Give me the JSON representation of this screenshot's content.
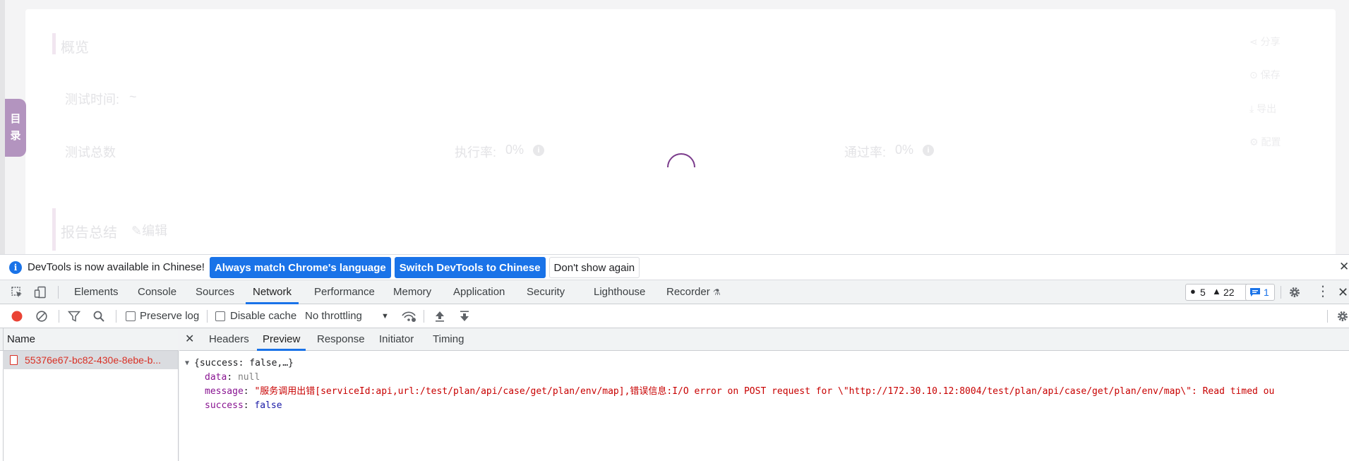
{
  "page": {
    "toc_tab": [
      "目",
      "录"
    ],
    "overview_title": "概览",
    "test_time_label": "测试时间:",
    "test_time_value": "~",
    "test_total_label": "测试总数",
    "exec_rate_label": "执行率:",
    "exec_rate_value": "0%",
    "pass_rate_label": "通过率:",
    "pass_rate_value": "0%",
    "report_summary_title": "报告总结",
    "edit_label": "编辑",
    "side_actions": [
      "分享",
      "保存",
      "导出",
      "配置"
    ]
  },
  "infobar": {
    "message": "DevTools is now available in Chinese!",
    "btn_match": "Always match Chrome's language",
    "btn_switch": "Switch DevTools to Chinese",
    "btn_dismiss": "Don't show again"
  },
  "main_tabs": [
    "Elements",
    "Console",
    "Sources",
    "Network",
    "Performance",
    "Memory",
    "Application",
    "Security",
    "Lighthouse",
    "Recorder"
  ],
  "active_main_tab": "Network",
  "badges": {
    "errors": "5",
    "warnings": "22",
    "messages": "1"
  },
  "network_toolbar": {
    "preserve_log": "Preserve log",
    "disable_cache": "Disable cache",
    "throttling": "No throttling"
  },
  "request_list": {
    "header": "Name",
    "rows": [
      {
        "name": "55376e67-bc82-430e-8ebe-b..."
      }
    ]
  },
  "detail_tabs": [
    "Headers",
    "Preview",
    "Response",
    "Initiator",
    "Timing"
  ],
  "active_detail_tab": "Preview",
  "preview": {
    "summary": "{success: false,…}",
    "data_key": "data",
    "data_value": "null",
    "message_key": "message",
    "message_value": "\"服务调用出错[serviceId:api,url:/test/plan/api/case/get/plan/env/map],错误信息:I/O error on POST request for \\\"http://172.30.10.12:8004/test/plan/api/case/get/plan/env/map\\\": Read timed ou",
    "success_key": "success",
    "success_value": "false"
  },
  "colors": {
    "accent": "#1a73e8",
    "error": "#d93025",
    "toc_purple": "#b394bf"
  }
}
